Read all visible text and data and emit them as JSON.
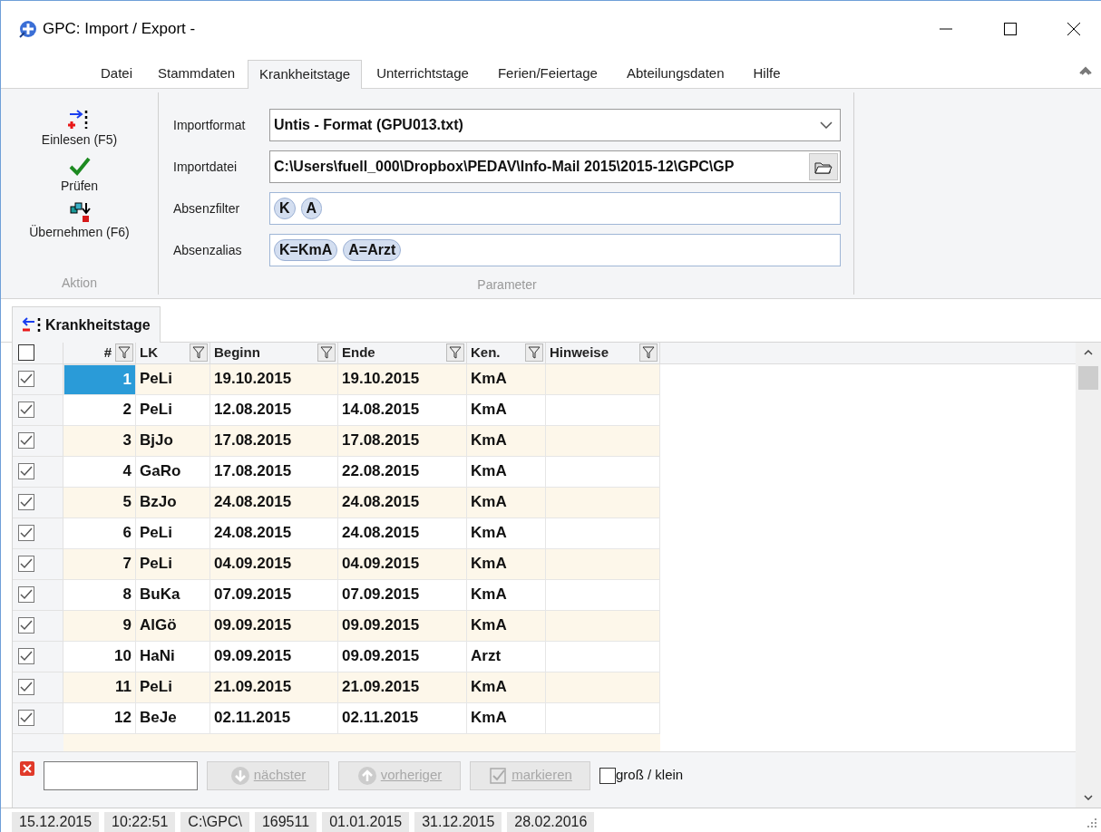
{
  "window": {
    "title": "GPC: Import / Export -"
  },
  "ribbon_tabs": [
    {
      "label": "Datei",
      "selected": false
    },
    {
      "label": "Stammdaten",
      "selected": false
    },
    {
      "label": "Krankheitstage",
      "selected": true
    },
    {
      "label": "Unterrichtstage",
      "selected": false
    },
    {
      "label": "Ferien/Feiertage",
      "selected": false
    },
    {
      "label": "Abteilungsdaten",
      "selected": false
    },
    {
      "label": "Hilfe",
      "selected": false
    }
  ],
  "actions": {
    "group_label": "Aktion",
    "buttons": [
      {
        "kind": "read",
        "label": "Einlesen (F5)"
      },
      {
        "kind": "check",
        "label": "Prüfen"
      },
      {
        "kind": "apply",
        "label": "Übernehmen (F6)"
      }
    ]
  },
  "parameters": {
    "group_label": "Parameter",
    "fields": [
      {
        "kind": "dropdown",
        "label": "Importformat",
        "value": "Untis - Format (GPU013.txt)"
      },
      {
        "kind": "file",
        "label": "Importdatei",
        "value": "C:\\Users\\fuell_000\\Dropbox\\PEDAV\\Info-Mail 2015\\2015-12\\GPC\\GP"
      },
      {
        "kind": "tokens",
        "label": "Absenzfilter",
        "tokens": [
          "K",
          "A"
        ]
      },
      {
        "kind": "tokens",
        "label": "Absenzalias",
        "tokens": [
          "K=KmA",
          "A=Arzt"
        ]
      }
    ]
  },
  "document_tab": {
    "label": "Krankheitstage"
  },
  "table": {
    "header_checked": false,
    "columns": [
      "#",
      "LK",
      "Beginn",
      "Ende",
      "Ken.",
      "Hinweise"
    ],
    "rows": [
      {
        "checked": true,
        "selected": true,
        "cells": [
          "1",
          "PeLi",
          "19.10.2015",
          "19.10.2015",
          "KmA",
          ""
        ]
      },
      {
        "checked": true,
        "selected": false,
        "cells": [
          "2",
          "PeLi",
          "12.08.2015",
          "14.08.2015",
          "KmA",
          ""
        ]
      },
      {
        "checked": true,
        "selected": false,
        "cells": [
          "3",
          "BjJo",
          "17.08.2015",
          "17.08.2015",
          "KmA",
          ""
        ]
      },
      {
        "checked": true,
        "selected": false,
        "cells": [
          "4",
          "GaRo",
          "17.08.2015",
          "22.08.2015",
          "KmA",
          ""
        ]
      },
      {
        "checked": true,
        "selected": false,
        "cells": [
          "5",
          "BzJo",
          "24.08.2015",
          "24.08.2015",
          "KmA",
          ""
        ]
      },
      {
        "checked": true,
        "selected": false,
        "cells": [
          "6",
          "PeLi",
          "24.08.2015",
          "24.08.2015",
          "KmA",
          ""
        ]
      },
      {
        "checked": true,
        "selected": false,
        "cells": [
          "7",
          "PeLi",
          "04.09.2015",
          "04.09.2015",
          "KmA",
          ""
        ]
      },
      {
        "checked": true,
        "selected": false,
        "cells": [
          "8",
          "BuKa",
          "07.09.2015",
          "07.09.2015",
          "KmA",
          ""
        ]
      },
      {
        "checked": true,
        "selected": false,
        "cells": [
          "9",
          "AlGö",
          "09.09.2015",
          "09.09.2015",
          "KmA",
          ""
        ]
      },
      {
        "checked": true,
        "selected": false,
        "cells": [
          "10",
          "HaNi",
          "09.09.2015",
          "09.09.2015",
          "Arzt",
          ""
        ]
      },
      {
        "checked": true,
        "selected": false,
        "cells": [
          "11",
          "PeLi",
          "21.09.2015",
          "21.09.2015",
          "KmA",
          ""
        ]
      },
      {
        "checked": true,
        "selected": false,
        "cells": [
          "12",
          "BeJe",
          "02.11.2015",
          "02.11.2015",
          "KmA",
          ""
        ]
      }
    ]
  },
  "search_bar": {
    "buttons": [
      {
        "kind": "down",
        "label": "nächster",
        "disabled": true
      },
      {
        "kind": "up",
        "label": "vorheriger",
        "disabled": true
      },
      {
        "kind": "mark",
        "label": "markieren",
        "disabled": true
      }
    ],
    "case_option": {
      "label": "groß / klein",
      "checked": false
    }
  },
  "status_bar": [
    "15.12.2015",
    "10:22:51",
    "C:\\GPC\\",
    "169511",
    "01.01.2015",
    "31.12.2015",
    "28.02.2016"
  ]
}
